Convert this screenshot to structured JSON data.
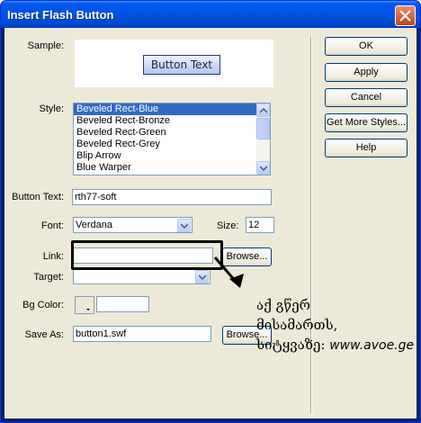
{
  "window": {
    "title": "Insert Flash Button"
  },
  "sample": {
    "label": "Sample:",
    "button_text": "Button Text"
  },
  "style": {
    "label": "Style:",
    "items": [
      "Beveled Rect-Blue",
      "Beveled Rect-Bronze",
      "Beveled Rect-Green",
      "Beveled Rect-Grey",
      "Blip Arrow",
      "Blue Warper"
    ],
    "selected_index": 0
  },
  "button_text": {
    "label": "Button Text:",
    "value": "rth77-soft"
  },
  "font": {
    "label": "Font:",
    "value": "Verdana",
    "size_label": "Size:",
    "size_value": "12"
  },
  "link": {
    "label": "Link:",
    "value": "",
    "browse_label": "Browse..."
  },
  "target": {
    "label": "Target:",
    "value": ""
  },
  "bg_color": {
    "label": "Bg Color:",
    "value": ""
  },
  "save_as": {
    "label": "Save As:",
    "value": "button1.swf",
    "browse_label": "Browse..."
  },
  "actions": {
    "ok": "OK",
    "apply": "Apply",
    "cancel": "Cancel",
    "more_styles": "Get More Styles...",
    "help": "Help"
  },
  "annotation": {
    "line1": "აქ გწერ",
    "line2": "მისამართს,",
    "line3": "სიტყვაზე:",
    "url": "www.avoe.ge"
  },
  "colors": {
    "titlebar": "#0054e3",
    "dialog_bg": "#ece9d8",
    "selection": "#316ac5",
    "annotation": "#000000"
  }
}
